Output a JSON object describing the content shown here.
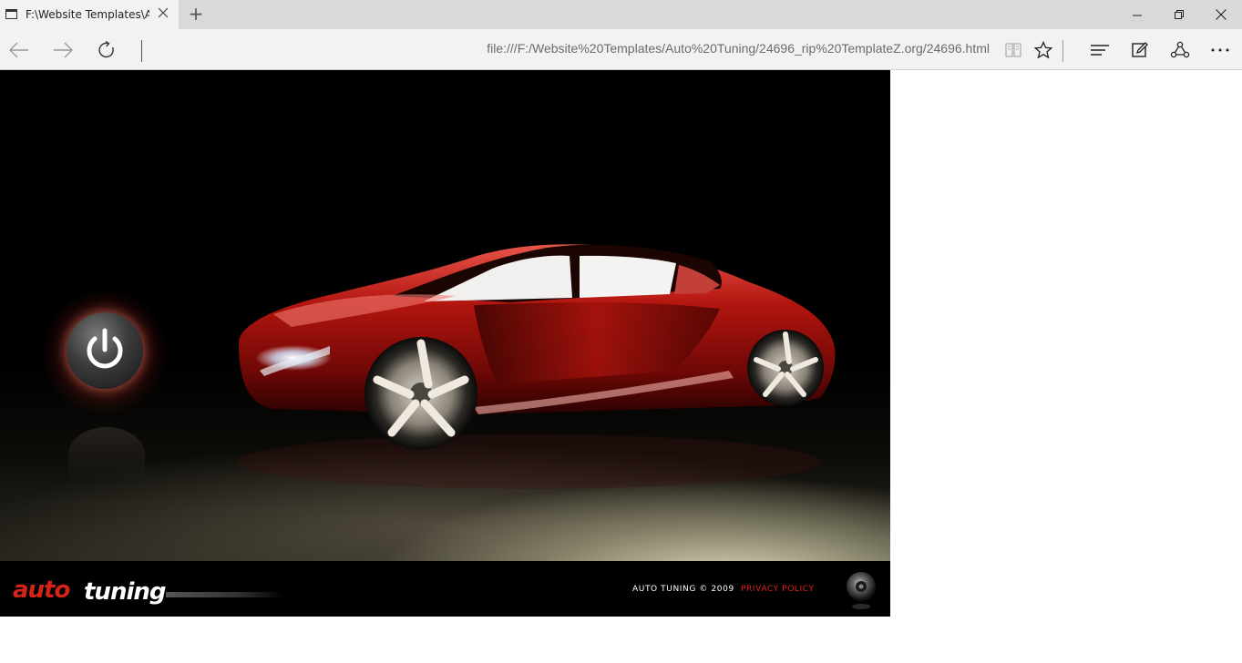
{
  "browser": {
    "tab_title": "F:\\Website Templates\\Auto Tuning",
    "new_tab_symbol": "+",
    "address": "file:///F:/Website%20Templates/Auto%20Tuning/24696_rip%20TemplateZ.org/24696.html"
  },
  "page": {
    "logo_text": "autotuning",
    "copyright": "AUTO TUNING © 2009",
    "privacy_link": "PRIVACY POLICY",
    "colors": {
      "accent_red": "#e0241b",
      "car_red": "#b3150f",
      "background": "#000000"
    }
  },
  "icons": {
    "page": "page-icon",
    "close": "close-icon",
    "back": "back-arrow-icon",
    "forward": "forward-arrow-icon",
    "refresh": "refresh-icon",
    "reading_view": "reading-view-icon",
    "favorite": "star-icon",
    "hub": "hub-icon",
    "web_note": "web-note-icon",
    "share": "share-icon",
    "more": "more-icon",
    "power": "power-icon",
    "sound": "speaker-icon"
  }
}
